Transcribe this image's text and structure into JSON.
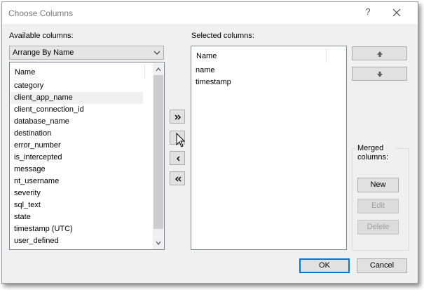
{
  "window": {
    "title": "Choose Columns",
    "help_label": "?"
  },
  "available": {
    "label": "Available columns:",
    "arrange_value": "Arrange By Name",
    "column_header": "Name",
    "items": [
      "category",
      "client_app_name",
      "client_connection_id",
      "database_name",
      "destination",
      "error_number",
      "is_intercepted",
      "message",
      "nt_username",
      "severity",
      "sql_text",
      "state",
      "timestamp (UTC)",
      "user_defined"
    ],
    "highlighted_item": "client_app_name"
  },
  "selected": {
    "label": "Selected columns:",
    "column_header": "Name",
    "items": [
      "name",
      "timestamp"
    ]
  },
  "transfer_buttons": [
    "add-all",
    "add",
    "remove",
    "remove-all"
  ],
  "merged": {
    "label": "Merged columns:",
    "new_label": "New",
    "edit_label": "Edit",
    "delete_label": "Delete"
  },
  "footer": {
    "ok_label": "OK",
    "cancel_label": "Cancel"
  },
  "colors": {
    "accent": "#0078d7",
    "dialog_bg": "#f0f0f0"
  }
}
